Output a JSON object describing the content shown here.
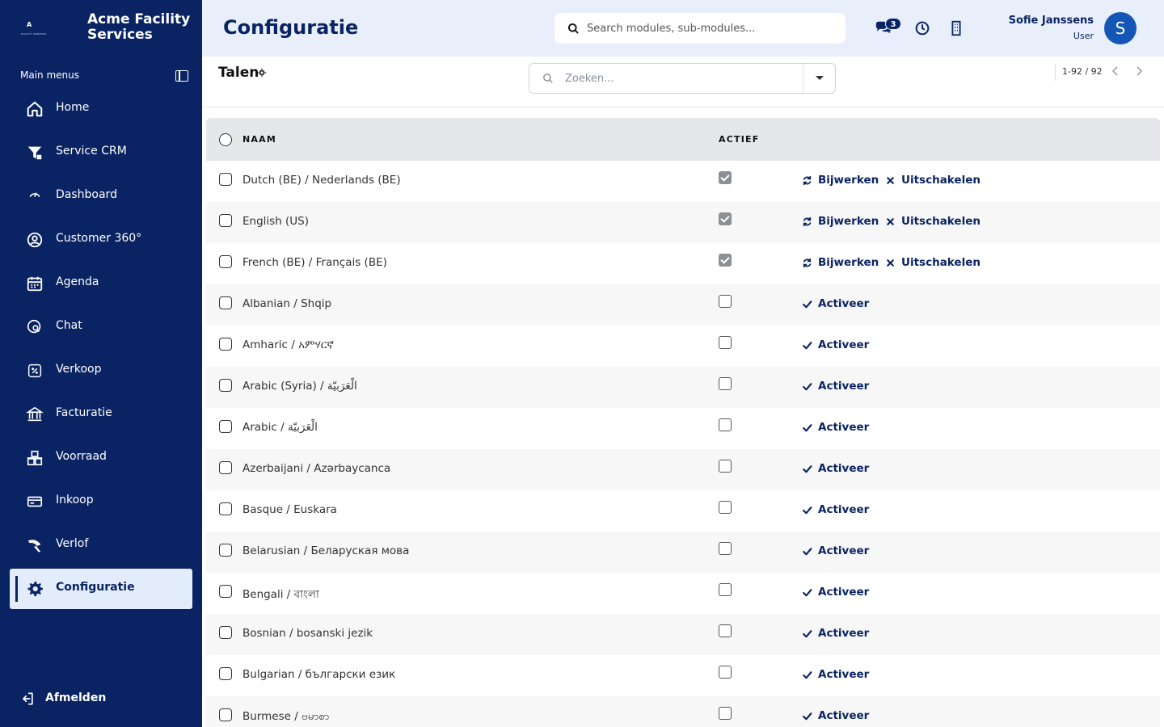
{
  "brand": {
    "logo_letter": "A",
    "logo_sub": "FACILITY SERVICES",
    "name_line1": "Acme Facility",
    "name_line2": "Services"
  },
  "sidebar": {
    "heading": "Main menus",
    "items": [
      {
        "label": "Home",
        "icon": "home-icon"
      },
      {
        "label": "Service CRM",
        "icon": "filter-icon"
      },
      {
        "label": "Dashboard",
        "icon": "gauge-icon"
      },
      {
        "label": "Customer 360°",
        "icon": "user-circle-icon"
      },
      {
        "label": "Agenda",
        "icon": "calendar-icon"
      },
      {
        "label": "Chat",
        "icon": "chat-icon"
      },
      {
        "label": "Verkoop",
        "icon": "percent-icon"
      },
      {
        "label": "Facturatie",
        "icon": "bank-icon"
      },
      {
        "label": "Voorraad",
        "icon": "warehouse-icon"
      },
      {
        "label": "Inkoop",
        "icon": "card-icon"
      },
      {
        "label": "Verlof",
        "icon": "plane-icon"
      },
      {
        "label": "Configuratie",
        "icon": "gear-icon",
        "active": true
      }
    ],
    "logout": "Afmelden"
  },
  "header": {
    "title": "Configuratie",
    "search_placeholder": "Search modules, sub-modules...",
    "chat_badge": "3",
    "user_name": "Sofie Janssens",
    "user_role": "User",
    "avatar_letter": "S"
  },
  "subheader": {
    "title": "Talen",
    "filter_placeholder": "Zoeken...",
    "pager": "1-92 / 92"
  },
  "table": {
    "col_name": "NAAM",
    "col_active": "ACTIEF",
    "action_update": "Bijwerken",
    "action_disable": "Uitschakelen",
    "action_activate": "Activeer",
    "rows": [
      {
        "name": "Dutch (BE) / Nederlands (BE)",
        "active": true
      },
      {
        "name": "English (US)",
        "active": true
      },
      {
        "name": "French (BE) / Français (BE)",
        "active": true
      },
      {
        "name": "Albanian / Shqip",
        "active": false
      },
      {
        "name": "Amharic / አምሃርኛ",
        "active": false
      },
      {
        "name": "Arabic (Syria) / الْعَرَبيّة",
        "active": false
      },
      {
        "name": "Arabic / الْعَرَبيّة",
        "active": false
      },
      {
        "name": "Azerbaijani / Azərbaycanca",
        "active": false
      },
      {
        "name": "Basque / Euskara",
        "active": false
      },
      {
        "name": "Belarusian / Беларуская мова",
        "active": false
      },
      {
        "name": "Bengali / বাংলা",
        "active": false
      },
      {
        "name": "Bosnian / bosanski jezik",
        "active": false
      },
      {
        "name": "Bulgarian / български език",
        "active": false
      },
      {
        "name": "Burmese / ဗမာစာ",
        "active": false
      }
    ]
  },
  "colors": {
    "navy": "#0a2463",
    "header_bg": "#e8effb",
    "active_nav_bg": "#e3ecfb",
    "avatar": "#1456b5"
  }
}
